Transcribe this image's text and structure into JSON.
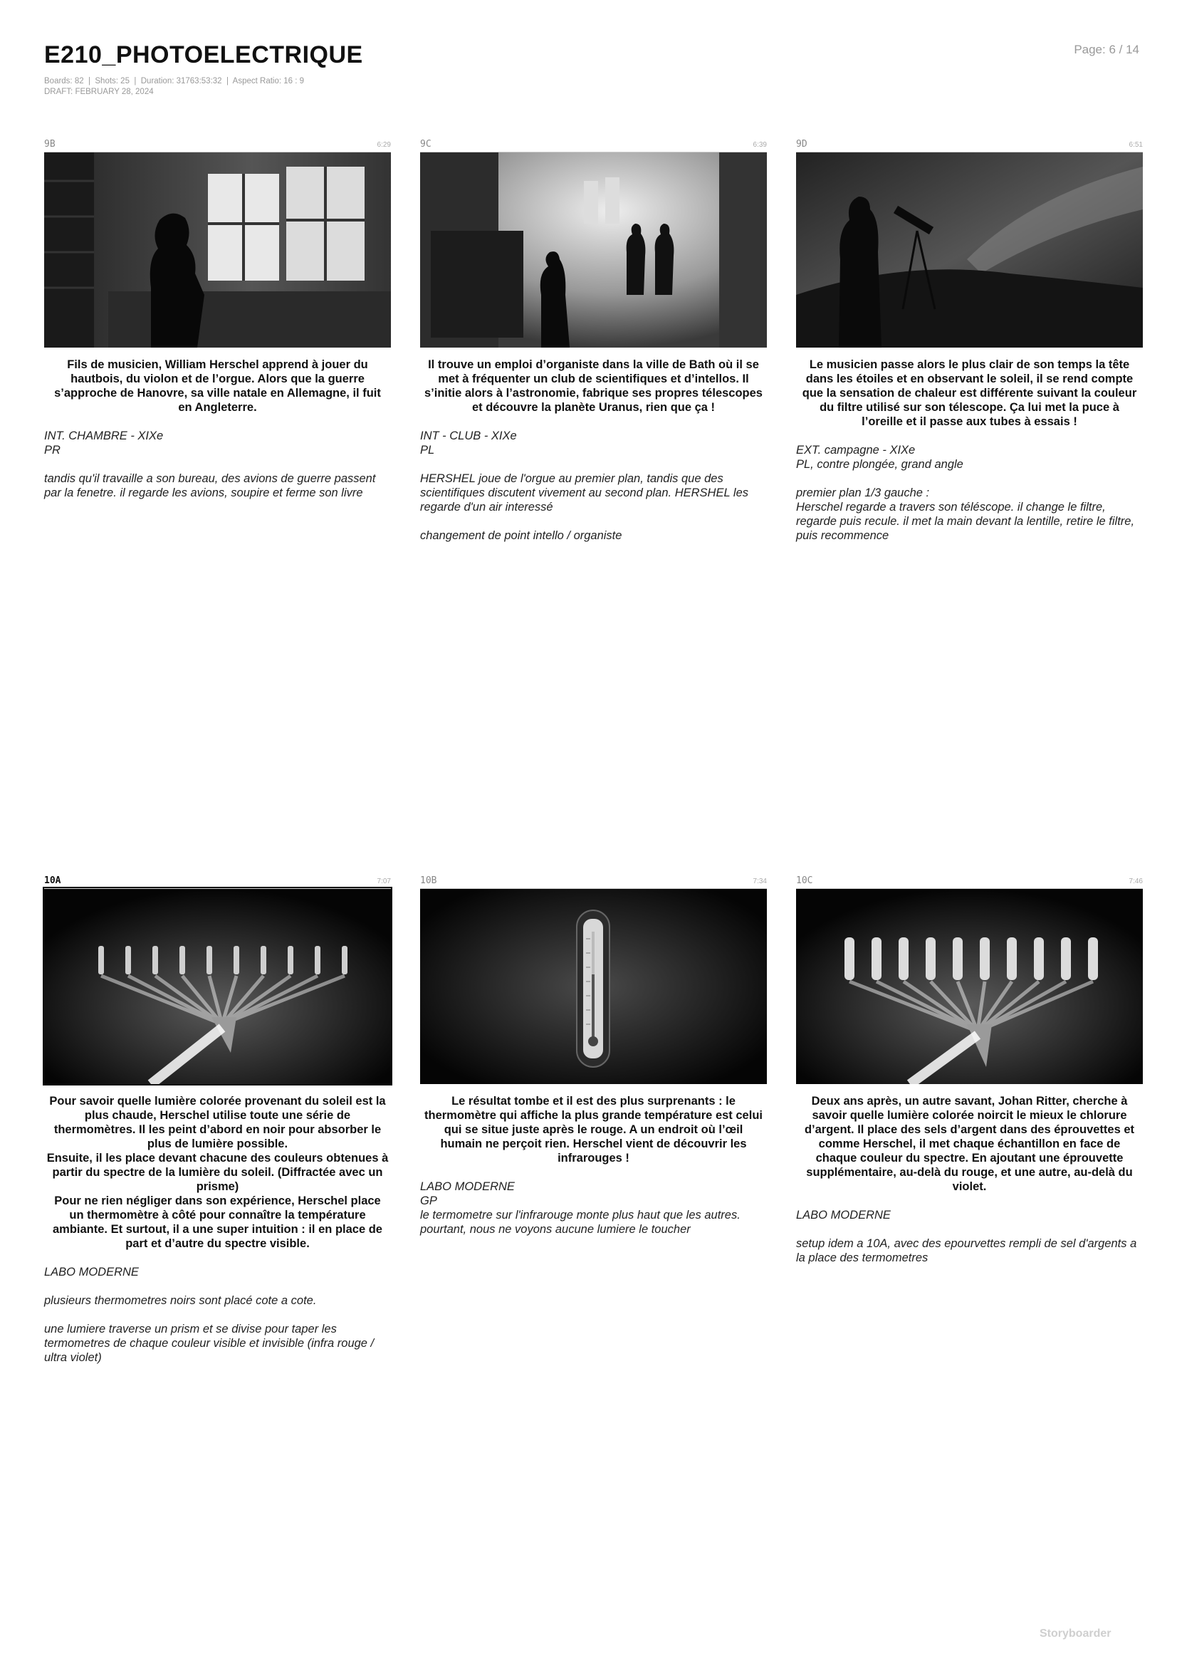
{
  "header": {
    "title": "E210_PHOTOELECTRIQUE",
    "meta_line1": "Boards: 82  |  Shots: 25  |  Duration: 31763:53:32  |  Aspect Ratio: 16 : 9",
    "meta_line2": "DRAFT: FEBRUARY 28, 2024",
    "page": "Page: 6 / 14"
  },
  "panels": [
    {
      "id": "9B",
      "time": "6:29",
      "caption": "Fils de musicien, William Herschel apprend à jouer du hautbois, du violon et de l’orgue. Alors que la guerre s’approche de Hanovre, sa ville natale en Allemagne, il fuit en Angleterre.",
      "notes": "INT. CHAMBRE - XIXe\nPR\n\ntandis qu'il travaille a son bureau, des avions de guerre passent par la fenetre. il regarde les avions, soupire et ferme son livre"
    },
    {
      "id": "9C",
      "time": "6:39",
      "caption": "Il trouve un emploi d’organiste dans la ville de Bath où il se met à fréquenter un club de scientifiques et d’intellos. Il s’initie alors à l’astronomie, fabrique ses propres télescopes et découvre la planète Uranus, rien que ça !",
      "notes": "INT - CLUB - XIXe\nPL\n\nHERSHEL joue de l'orgue au premier plan, tandis que des scientifiques discutent vivement au second plan. HERSHEL les regarde d'un air interessé\n\nchangement de point intello / organiste"
    },
    {
      "id": "9D",
      "time": "6:51",
      "caption": "Le musicien passe alors le plus clair de son temps la tête dans les étoiles et en observant le soleil, il se rend compte que la sensation de chaleur est différente suivant la couleur du filtre utilisé sur son télescope. Ça lui met la puce à l’oreille et il passe aux tubes à essais !",
      "notes": "EXT. campagne - XIXe\nPL, contre plongée, grand angle\n\npremier plan 1/3 gauche :\nHerschel regarde a travers son téléscope. il change le filtre, regarde puis recule. il met la main devant la lentille, retire le filtre, puis recommence"
    },
    {
      "id": "10A",
      "time": "7:07",
      "caption": "Pour savoir quelle lumière colorée provenant du soleil est la plus chaude, Herschel utilise toute une série de thermomètres. Il les peint d’abord en noir pour absorber le plus de lumière possible.\nEnsuite, il les place devant chacune des couleurs obtenues à partir du spectre de la lumière du soleil. (Diffractée avec un prisme)\nPour ne rien négliger dans son expérience, Herschel place un thermomètre à côté pour connaître la température ambiante. Et surtout, il a une super intuition : il en place de part et d’autre du spectre visible.",
      "notes": "LABO MODERNE\n\nplusieurs thermometres noirs sont placé cote a cote.\n\nune lumiere traverse un prism et se divise pour taper les termometres de chaque couleur visible et invisible (infra rouge / ultra violet)"
    },
    {
      "id": "10B",
      "time": "7:34",
      "caption": "Le résultat tombe et il est des plus surprenants : le thermomètre qui affiche la plus grande température est celui qui se situe juste après le rouge. A un endroit où l’œil humain ne perçoit rien. Herschel vient de découvrir les infrarouges !",
      "notes": "LABO MODERNE\nGP\nle termometre sur l'infrarouge monte plus haut que les autres. pourtant, nous ne voyons aucune lumiere le toucher"
    },
    {
      "id": "10C",
      "time": "7:46",
      "caption": "Deux ans après, un autre savant, Johan Ritter, cherche à savoir quelle lumière colorée noircit le mieux le chlorure d’argent. Il place des sels d’argent dans des éprouvettes et comme Herschel, il met chaque échantillon en face de chaque couleur du spectre. En ajoutant une éprouvette supplémentaire, au-delà du rouge, et une autre, au-delà du violet.",
      "notes": "LABO MODERNE\n\nsetup idem a 10A, avec des epourvettes rempli de sel d'argents a la place des termometres"
    }
  ],
  "footer": {
    "brand": "Storyboarder"
  }
}
